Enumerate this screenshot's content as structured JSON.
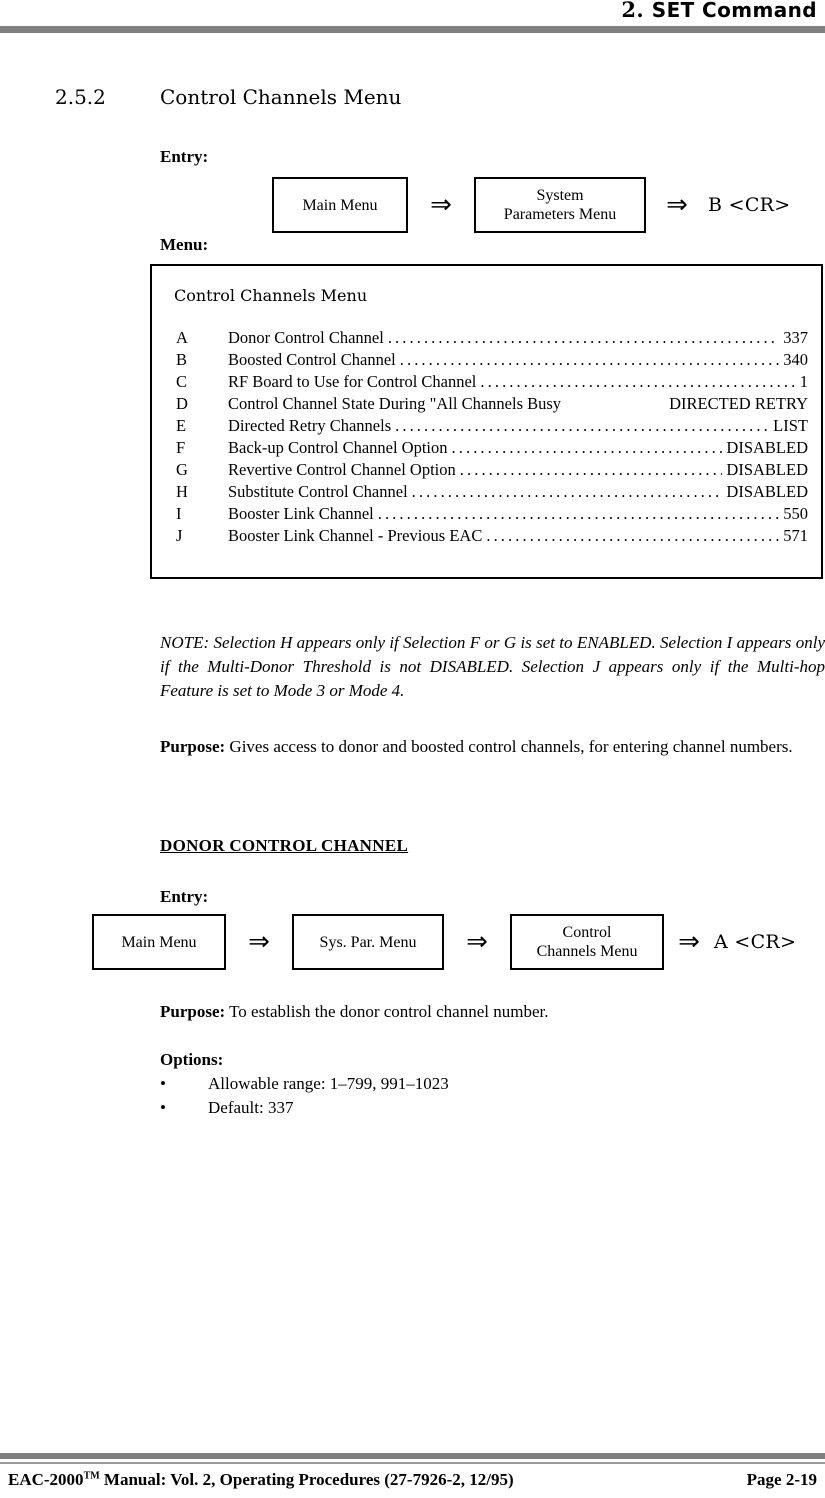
{
  "header": {
    "chapter_number": "2.",
    "chapter_title": "SET Command"
  },
  "section": {
    "number": "2.5.2",
    "title": "Control Channels Menu"
  },
  "entry_1": {
    "label": "Entry:",
    "box_1": "Main Menu",
    "arrow_1": "⇒",
    "box_2_line_1": "System",
    "box_2_line_2": "Parameters Menu",
    "arrow_2": "⇒",
    "key": "B <CR>"
  },
  "menu": {
    "label": "Menu:",
    "title": "Control Channels Menu",
    "rows": [
      {
        "key": "A",
        "label": "Donor Control Channel",
        "value": "337"
      },
      {
        "key": "B",
        "label": "Boosted Control Channel",
        "value": "340"
      },
      {
        "key": "C",
        "label": "RF Board to Use for Control Channel",
        "value": "1"
      },
      {
        "key": "D",
        "label": "Control Channel State During \"All Channels Busy",
        "value": "DIRECTED RETRY",
        "dots": false
      },
      {
        "key": "E",
        "label": "Directed Retry Channels",
        "value": "LIST"
      },
      {
        "key": "F",
        "label": "Back-up Control Channel Option",
        "value": "DISABLED"
      },
      {
        "key": "G",
        "label": "Revertive Control Channel Option",
        "value": "DISABLED"
      },
      {
        "key": "H",
        "label": "Substitute Control Channel",
        "value": "DISABLED"
      },
      {
        "key": "I",
        "label": "Booster Link Channel",
        "value": "550"
      },
      {
        "key": "J",
        "label": "Booster Link Channel - Previous EAC",
        "value": "571"
      }
    ]
  },
  "note": {
    "lead": "NOTE:",
    "body": "  Selection H appears only if Selection F or G is set to ENABLED. Selection I appears only if the Multi-Donor Threshold is not DISABLED. Selection J appears only if the Multi-hop Feature is set to Mode 3 or Mode 4."
  },
  "purpose_1": {
    "label": "Purpose:",
    "body": "  Gives access to donor and boosted control channels, for entering channel numbers."
  },
  "donor_section": {
    "heading": "DONOR CONTROL CHANNEL"
  },
  "entry_2": {
    "label": "Entry:",
    "box_1": "Main Menu",
    "arrow_1": "⇒",
    "box_2": "Sys. Par. Menu",
    "arrow_2": "⇒",
    "box_3_line_1": "Control",
    "box_3_line_2": "Channels Menu",
    "arrow_3": "⇒",
    "key": "A <CR>"
  },
  "purpose_2": {
    "label": "Purpose:",
    "body": "  To establish the donor control channel number."
  },
  "options": {
    "label": "Options:",
    "items": [
      {
        "bullet": "•",
        "text": "Allowable range:  1–799, 991–1023"
      },
      {
        "bullet": "•",
        "text": "Default:  337"
      }
    ]
  },
  "footer": {
    "manual": "EAC-2000",
    "trademark": "TM",
    "manual_rest": " Manual:  Vol. 2, Operating Procedures (27-7926-2, 12/95)",
    "page": "Page 2-19"
  },
  "colors": {
    "rule_gray": "#808080",
    "rule_gray_light": "#9a9a9a",
    "text": "#000000",
    "page_bg": "#ffffff"
  }
}
